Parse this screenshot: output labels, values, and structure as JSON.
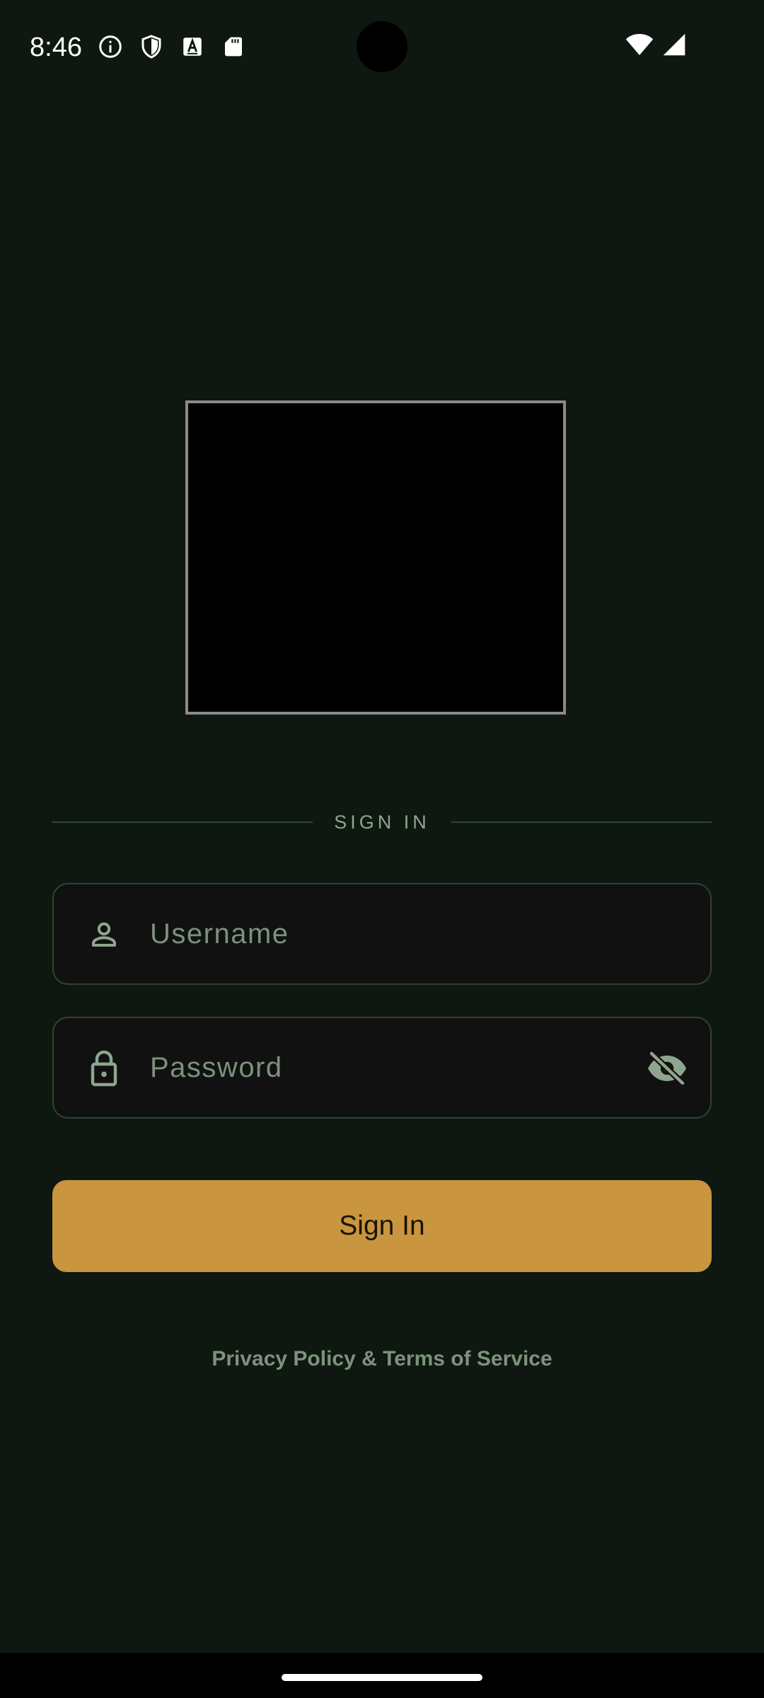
{
  "status_bar": {
    "time": "8:46",
    "left_icons": [
      "info-icon",
      "shield-icon",
      "text-accessibility-icon",
      "sd-card-icon"
    ],
    "right_icons": [
      "wifi-icon",
      "cell-signal-icon"
    ]
  },
  "logo": {
    "icon": "app-logo-placeholder"
  },
  "divider": {
    "label": "SIGN IN"
  },
  "form": {
    "username": {
      "placeholder": "Username",
      "value": "",
      "icon": "person-icon"
    },
    "password": {
      "placeholder": "Password",
      "value": "",
      "icon": "lock-icon",
      "toggle_icon": "eye-off-icon"
    },
    "submit_label": "Sign In"
  },
  "footer": {
    "legal_link": "Privacy Policy & Terms of Service"
  },
  "colors": {
    "background": "#0e1710",
    "accent": "#c9953e",
    "field_background": "#111111",
    "field_border": "#2d4530",
    "muted_text": "#7d927d"
  }
}
